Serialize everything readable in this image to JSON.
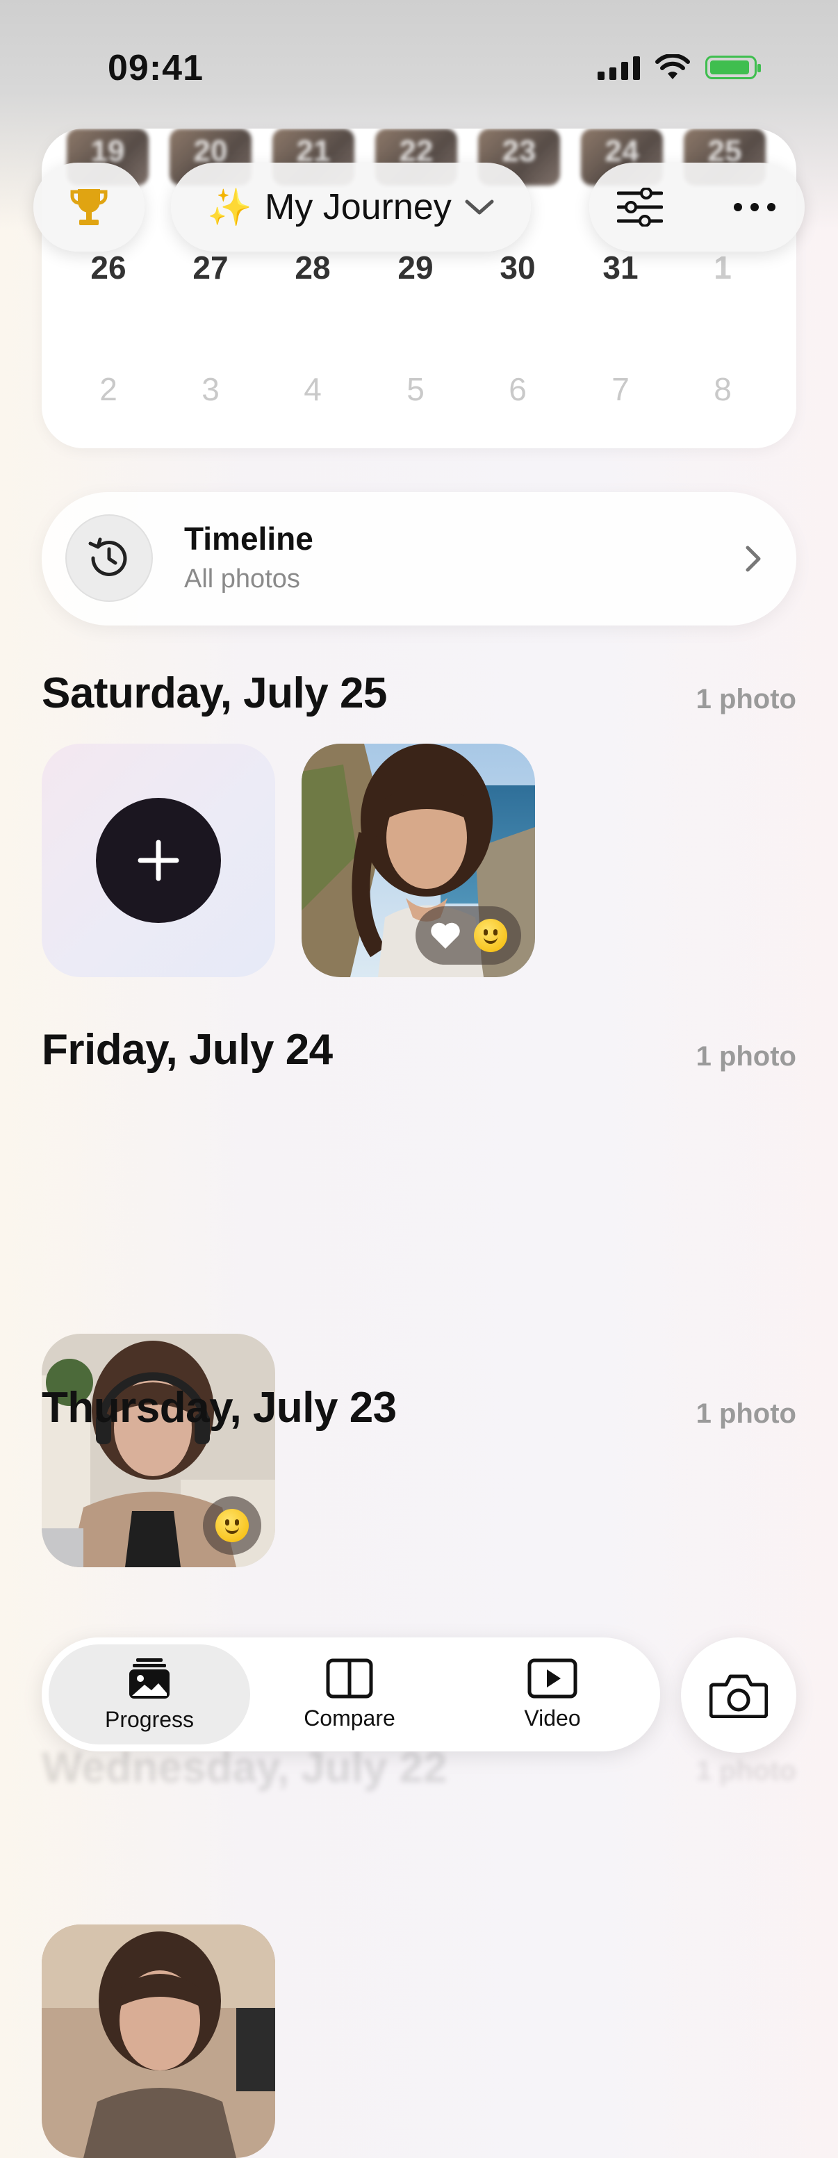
{
  "status_bar": {
    "time": "09:41"
  },
  "calendar": {
    "top_thumbs": [
      "19",
      "20",
      "21",
      "22",
      "23",
      "24",
      "25"
    ],
    "week1": [
      "26",
      "27",
      "28",
      "29",
      "30",
      "31",
      "1"
    ],
    "week2": [
      "2",
      "3",
      "4",
      "5",
      "6",
      "7",
      "8"
    ]
  },
  "toolbar": {
    "journey_label": "My Journey",
    "journey_emoji": "✨"
  },
  "timeline": {
    "title": "Timeline",
    "subtitle": "All photos"
  },
  "sections": [
    {
      "title": "Saturday, July 25",
      "count": "1 photo"
    },
    {
      "title": "Friday, July 24",
      "count": "1 photo"
    },
    {
      "title": "Thursday, July 23",
      "count": "1 photo"
    },
    {
      "title": "Wednesday, July 22",
      "count": "1 photo"
    }
  ],
  "tabs": {
    "progress": "Progress",
    "compare": "Compare",
    "video": "Video"
  },
  "colors": {
    "accent_dark": "#1b1620",
    "battery": "#3fbe4f",
    "trophy": "#e0a412"
  },
  "icons": [
    "trophy-icon",
    "chevron-down-icon",
    "sliders-icon",
    "more-icon",
    "history-icon",
    "chevron-right-icon",
    "plus-icon",
    "heart-icon",
    "smile-emoji-icon",
    "camera-icon",
    "photos-stack-icon",
    "compare-icon",
    "video-play-icon"
  ]
}
